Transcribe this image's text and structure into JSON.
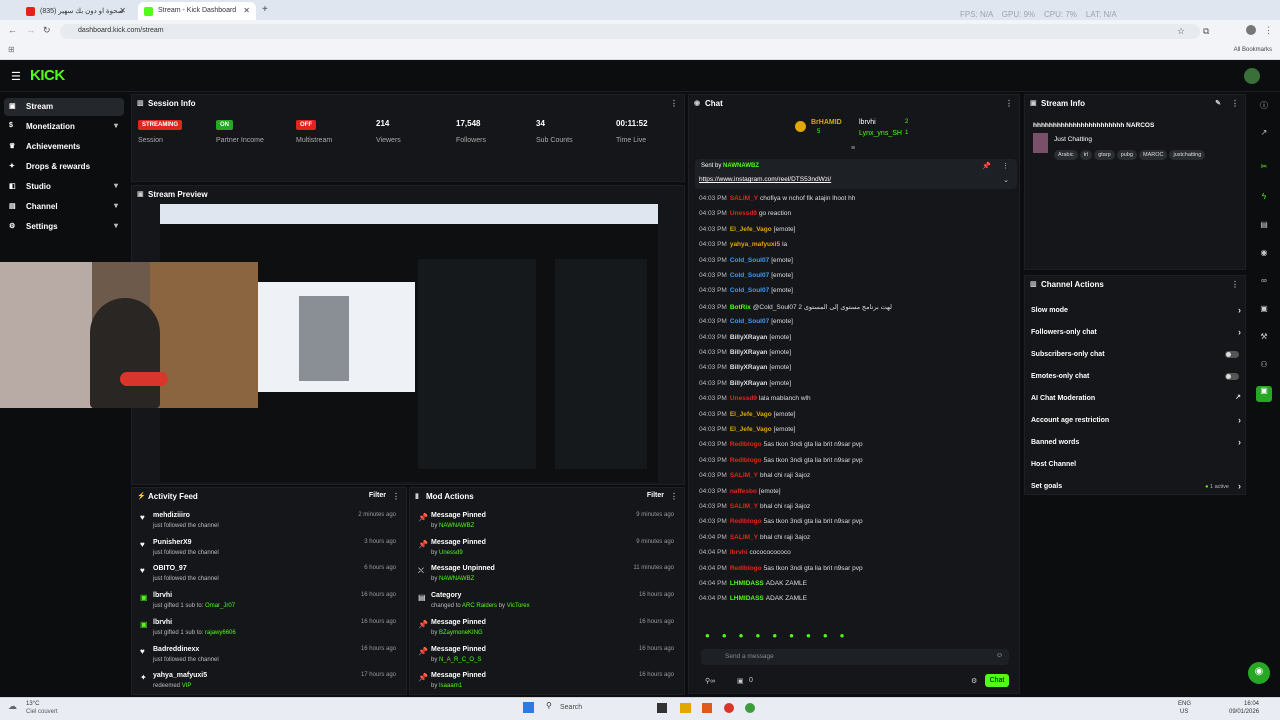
{
  "browser": {
    "tabs": [
      {
        "label": "(835) صحوة او دون بك سهير",
        "active": false
      },
      {
        "label": "Stream - Kick Dashboard",
        "active": true
      }
    ],
    "url": "dashboard.kick.com/stream",
    "bookmarks_label": "All Bookmarks",
    "overlay_stats": "FPS: N/A    GPU: 9%    CPU: 7%    LAT: N/A"
  },
  "app": {
    "logo": "KICK"
  },
  "sidebar": {
    "items": [
      {
        "label": "Stream",
        "icon": "stream-icon",
        "active": true,
        "chevron": false
      },
      {
        "label": "Monetization",
        "icon": "dollar-icon",
        "chevron": true
      },
      {
        "label": "Achievements",
        "icon": "trophy-icon",
        "chevron": false
      },
      {
        "label": "Drops & rewards",
        "icon": "gift-icon",
        "chevron": false
      },
      {
        "label": "Studio",
        "icon": "studio-icon",
        "chevron": true
      },
      {
        "label": "Channel",
        "icon": "channel-icon",
        "chevron": true
      },
      {
        "label": "Settings",
        "icon": "gear-icon",
        "chevron": true
      }
    ]
  },
  "session": {
    "title": "Session Info",
    "stats": [
      {
        "value": "STREAMING",
        "label": "Session",
        "badge": "#e0261c"
      },
      {
        "value": "ON",
        "label": "Partner Income",
        "badge": "#26a825"
      },
      {
        "value": "OFF",
        "label": "Multistream",
        "badge": "#e0261c"
      },
      {
        "value": "214",
        "label": "Viewers"
      },
      {
        "value": "17,548",
        "label": "Followers"
      },
      {
        "value": "34",
        "label": "Sub Counts"
      },
      {
        "value": "00:11:52",
        "label": "Time Live"
      }
    ]
  },
  "preview": {
    "title": "Stream Preview"
  },
  "activity": {
    "title": "Activity Feed",
    "filter": "Filter",
    "items": [
      {
        "icon": "heart-icon",
        "name": "mehdiziiiro",
        "desc": "just followed the channel",
        "time": "2 minutes ago"
      },
      {
        "icon": "heart-icon",
        "name": "PunisherX9",
        "desc": "just followed the channel",
        "time": "3 hours ago"
      },
      {
        "icon": "heart-icon",
        "name": "OBITO_97",
        "desc": "just followed the channel",
        "time": "6 hours ago"
      },
      {
        "icon": "gift-icon",
        "name": "lbrvhi",
        "desc": "just gifted 1 sub to: ",
        "hl": "Omar_Jr07",
        "time": "16 hours ago"
      },
      {
        "icon": "gift-icon",
        "name": "lbrvhi",
        "desc": "just gifted 1 sub to: ",
        "hl": "rajawy6606",
        "time": "16 hours ago"
      },
      {
        "icon": "heart-icon",
        "name": "Badreddinexx",
        "desc": "just followed the channel",
        "time": "16 hours ago"
      },
      {
        "icon": "star-icon",
        "name": "yahya_mafyuxi5",
        "desc": "redeemed ",
        "hl": "VIP",
        "time": "17 hours ago"
      }
    ]
  },
  "mod_actions": {
    "title": "Mod Actions",
    "filter": "Filter",
    "items": [
      {
        "icon": "pin-icon",
        "name": "Message Pinned",
        "desc": "by ",
        "hl": "NAWNAWBZ",
        "time": "9 minutes ago"
      },
      {
        "icon": "pin-icon",
        "name": "Message Pinned",
        "desc": "by ",
        "hl": "Unessd9",
        "time": "9 minutes ago"
      },
      {
        "icon": "unpin-icon",
        "name": "Message Unpinned",
        "desc": "by ",
        "hl": "NAWNAWBZ",
        "time": "11 minutes ago"
      },
      {
        "icon": "category-icon",
        "name": "Category",
        "desc": "changed to ",
        "hl": "ARC Raiders",
        "desc2": " by ",
        "hl2": "VicTorex",
        "time": "16 hours ago"
      },
      {
        "icon": "pin-icon",
        "name": "Message Pinned",
        "desc": "by ",
        "hl": "BZaymoneKING",
        "time": "16 hours ago"
      },
      {
        "icon": "pin-icon",
        "name": "Message Pinned",
        "desc": "by ",
        "hl": "N_A_R_C_O_S",
        "time": "16 hours ago"
      },
      {
        "icon": "pin-icon",
        "name": "Message Pinned",
        "desc": "by ",
        "hl": "Isaaam1",
        "time": "16 hours ago"
      }
    ]
  },
  "chat": {
    "title": "Chat",
    "top_gifters": [
      {
        "name": "BrHAMID",
        "count": "5"
      },
      {
        "name": "lbrvhi",
        "count": "2"
      },
      {
        "name": "Lynx_yns_SH",
        "count": "1"
      }
    ],
    "pinned": {
      "sent_by": "Sent by",
      "user": "NAWNAWBZ",
      "link": "https://www.instagram.com/reel/DTS53ndWzi/"
    },
    "messages": [
      {
        "time": "04:03 PM",
        "user": "SALIM_Y",
        "color": "#e0261c",
        "text": "chofiya w nchof fik atajin lhoot hh"
      },
      {
        "time": "04:03 PM",
        "user": "Unessd9",
        "color": "#e0261c",
        "text": "go reaction"
      },
      {
        "time": "04:03 PM",
        "user": "El_Jefe_Vago",
        "color": "#e0a800",
        "text": "[emote]"
      },
      {
        "time": "04:03 PM",
        "user": "yahya_mafyuxi5",
        "color": "#e0a800",
        "text": "la"
      },
      {
        "time": "04:03 PM",
        "user": "Cold_Soul07",
        "color": "#3b9dff",
        "text": "[emote]"
      },
      {
        "time": "04:03 PM",
        "user": "Cold_Soul07",
        "color": "#3b9dff",
        "text": "[emote]"
      },
      {
        "time": "04:03 PM",
        "user": "Cold_Soul07",
        "color": "#3b9dff",
        "text": "[emote]"
      },
      {
        "time": "04:03 PM",
        "user": "BotRix",
        "color": "#53fc18",
        "text": "@Cold_Soul07 2 لهت برنامج مستوى إلى المستوى"
      },
      {
        "time": "04:03 PM",
        "user": "Cold_Soul07",
        "color": "#3b9dff",
        "text": "[emote]"
      },
      {
        "time": "04:03 PM",
        "user": "BillyXRayan",
        "color": "#ddd",
        "text": "[emote]"
      },
      {
        "time": "04:03 PM",
        "user": "BillyXRayan",
        "color": "#ddd",
        "text": "[emote]"
      },
      {
        "time": "04:03 PM",
        "user": "BillyXRayan",
        "color": "#ddd",
        "text": "[emote]"
      },
      {
        "time": "04:03 PM",
        "user": "BillyXRayan",
        "color": "#ddd",
        "text": "[emote]"
      },
      {
        "time": "04:03 PM",
        "user": "Unessd9",
        "color": "#e0261c",
        "text": "lala mablanch wlh"
      },
      {
        "time": "04:03 PM",
        "user": "El_Jefe_Vago",
        "color": "#e0a800",
        "text": "[emote]"
      },
      {
        "time": "04:03 PM",
        "user": "El_Jefe_Vago",
        "color": "#e0a800",
        "text": "[emote]"
      },
      {
        "time": "04:03 PM",
        "user": "Redlblogo",
        "color": "#e0261c",
        "text": "5as tkon 3ndi gta lia brit n9sar pvp"
      },
      {
        "time": "04:03 PM",
        "user": "Redlblogo",
        "color": "#e0261c",
        "text": "5as tkon 3ndi gta lia brit n9sar pvp"
      },
      {
        "time": "04:03 PM",
        "user": "SALIM_Y",
        "color": "#e0261c",
        "text": "bhal chi raji 3ajoz"
      },
      {
        "time": "04:03 PM",
        "user": "naffesbo",
        "color": "#e0261c",
        "text": "[emote]"
      },
      {
        "time": "04:03 PM",
        "user": "SALIM_Y",
        "color": "#e0261c",
        "text": "bhal chi raji 3ajoz"
      },
      {
        "time": "04:03 PM",
        "user": "Redlblogo",
        "color": "#e0261c",
        "text": "5as tkon 3ndi gta lia brit n9sar pvp"
      },
      {
        "time": "04:04 PM",
        "user": "SALIM_Y",
        "color": "#e0261c",
        "text": "bhal chi raji 3ajoz"
      },
      {
        "time": "04:04 PM",
        "user": "lbrvhi",
        "color": "#e0261c",
        "text": "cocococococo"
      },
      {
        "time": "04:04 PM",
        "user": "Redlblogo",
        "color": "#e0261c",
        "text": "5as tkon 3ndi gta lia brit n9sar pvp"
      },
      {
        "time": "04:04 PM",
        "user": "LHMIDASS",
        "color": "#53fc18",
        "text": "ADAK ZAMLE"
      },
      {
        "time": "04:04 PM",
        "user": "LHMIDASS",
        "color": "#53fc18",
        "text": "ADAK ZAMLE"
      }
    ],
    "input_placeholder": "Send a message",
    "send_label": "Chat",
    "footer_count": "0"
  },
  "stream_info": {
    "title": "Stream Info",
    "stream_title": "hhhhhhhhhhhhhhhhhhhhhhh NARCOS",
    "category": "Just Chatting",
    "tags": [
      "Arabic",
      "trl",
      "gtarp",
      "pubg",
      "MAROC",
      "justchatting"
    ]
  },
  "channel_actions": {
    "title": "Channel Actions",
    "items": [
      {
        "label": "Slow mode",
        "control": "arrow"
      },
      {
        "label": "Followers-only chat",
        "control": "arrow"
      },
      {
        "label": "Subscribers-only chat",
        "control": "toggle"
      },
      {
        "label": "Emotes-only chat",
        "control": "toggle"
      },
      {
        "label": "AI Chat Moderation",
        "control": "external"
      },
      {
        "label": "Account age restriction",
        "control": "arrow"
      },
      {
        "label": "Banned words",
        "control": "arrow"
      },
      {
        "label": "Host Channel",
        "control": "none"
      },
      {
        "label": "Set goals",
        "control": "arrow",
        "status": "1 active"
      }
    ]
  },
  "taskbar": {
    "weather_temp": "13°C",
    "weather_desc": "Ciel couvert",
    "search": "Search",
    "lang": "ENG",
    "region": "US",
    "time": "16:04",
    "date": "09/01/2026"
  },
  "colors": {
    "accent": "#53fc18",
    "live_red": "#e0261c",
    "panel": "#141619"
  }
}
